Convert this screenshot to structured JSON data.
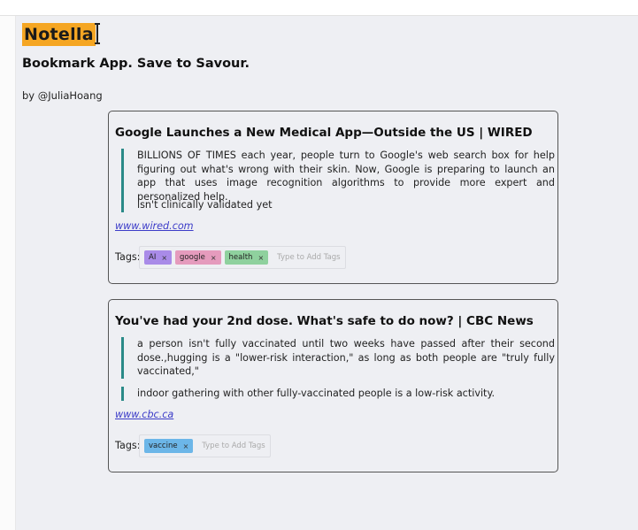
{
  "app": {
    "logo": "Notella",
    "tagline": "Bookmark App. Save to Savour.",
    "byline": "by @JuliaHoang"
  },
  "bookmarks": [
    {
      "title": "Google Launches a New Medical App—Outside the US | WIRED",
      "highlights": [
        "BILLIONS OF TIMES each year, people turn to Google's web search box for help figuring out what's wrong with their skin. Now, Google is preparing to launch an app that uses image recognition algorithms to provide more expert and personalized help.",
        "isn't clinically validated yet"
      ],
      "link": "www.wired.com",
      "tags_label": "Tags:",
      "tags": [
        {
          "label": "AI",
          "remove": "×",
          "color": "#a98be8"
        },
        {
          "label": "google",
          "remove": "×",
          "color": "#e59bbd"
        },
        {
          "label": "health",
          "remove": "×",
          "color": "#8fd19e"
        }
      ],
      "tag_placeholder": "Type to Add Tags"
    },
    {
      "title": "You've had your 2nd dose. What's safe to do now? | CBC News",
      "highlights": [
        "a person isn't fully vaccinated until two weeks have passed after their second dose.,hugging is a \"lower-risk interaction,\" as long as both people are \"truly fully vaccinated,\"",
        "indoor gathering with other fully-vaccinated people is a low-risk activity."
      ],
      "link": "www.cbc.ca",
      "tags_label": "Tags:",
      "tags": [
        {
          "label": "vaccine",
          "remove": "×",
          "color": "#6cb6e8"
        }
      ],
      "tag_placeholder": "Type to Add Tags"
    }
  ]
}
